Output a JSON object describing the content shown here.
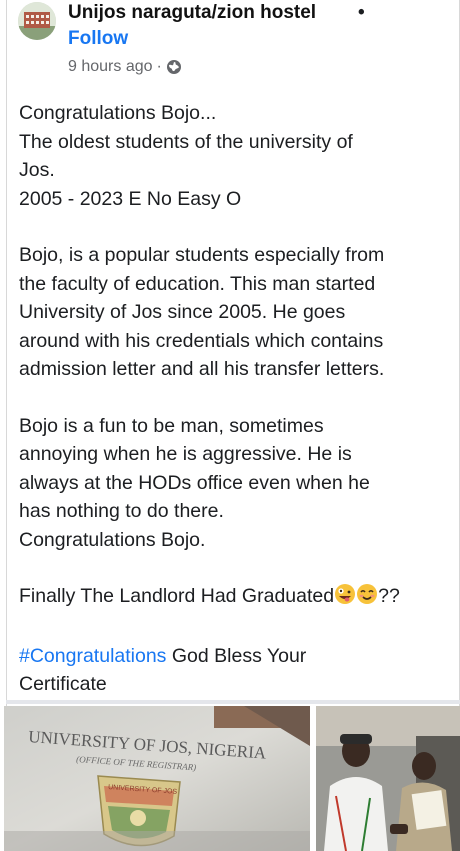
{
  "post": {
    "page_name": "Unijos naraguta/zion hostel",
    "separator_dot": "•",
    "follow_label": "Follow",
    "timestamp": "9 hours ago",
    "meta_sep": "·",
    "privacy_icon": "globe-icon"
  },
  "content": {
    "lines_1": [
      "Congratulations Bojo...",
      "The oldest students of the university of",
      "Jos.",
      "2005 - 2023 E No Easy O"
    ],
    "para_2": [
      "Bojo, is a popular students especially from",
      "the faculty of education. This man started",
      "University of Jos since 2005. He goes",
      "around with his credentials which contains",
      "admission letter and all his transfer letters."
    ],
    "para_3": [
      "Bojo is a fun to be man, sometimes",
      "annoying when he is aggressive. He is",
      "always at the HODs office even when he",
      "has nothing to do there.",
      "Congratulations Bojo."
    ],
    "finally_text": "Finally The Landlord Had Graduated",
    "finally_suffix": "??",
    "hashtag": "#Congratulations",
    "hashtag_rest": " God Bless Your",
    "last_line": "Certificate"
  },
  "photos": {
    "certificate_header": "UNIVERSITY OF JOS, NIGERIA",
    "certificate_sub": "(OFFICE OF THE REGISTRAR)",
    "seal_text": "UNIVERSITY OF JOS"
  },
  "colors": {
    "link": "#1877f2",
    "text": "#1c1e21",
    "meta": "#65676b"
  }
}
